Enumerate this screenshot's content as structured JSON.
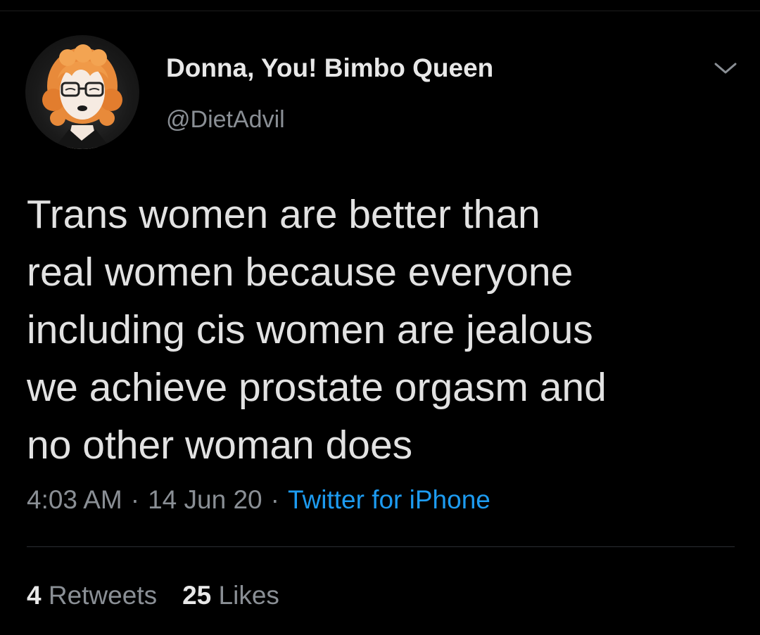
{
  "tweet": {
    "author": {
      "display_name": "Donna, You! Bimbo Queen",
      "handle": "@DietAdvil",
      "avatar_icon": "illustrated-avatar-orange-curly-hair-glasses"
    },
    "menu_icon": "chevron-down-icon",
    "text_lines": [
      "Trans women are better than",
      "real women because everyone",
      "including cis women are jealous",
      "we achieve prostate orgasm and",
      "no other woman does"
    ],
    "time": "4:03 AM",
    "separator": "·",
    "date": "14 Jun 20",
    "source": "Twitter for iPhone",
    "retweets": {
      "count": "4",
      "label": "Retweets"
    },
    "likes": {
      "count": "25",
      "label": "Likes"
    }
  },
  "colors": {
    "background": "#000000",
    "link": "#1d9bf0",
    "secondary_text": "#8a8f95",
    "primary_text": "#e2e2e2"
  }
}
